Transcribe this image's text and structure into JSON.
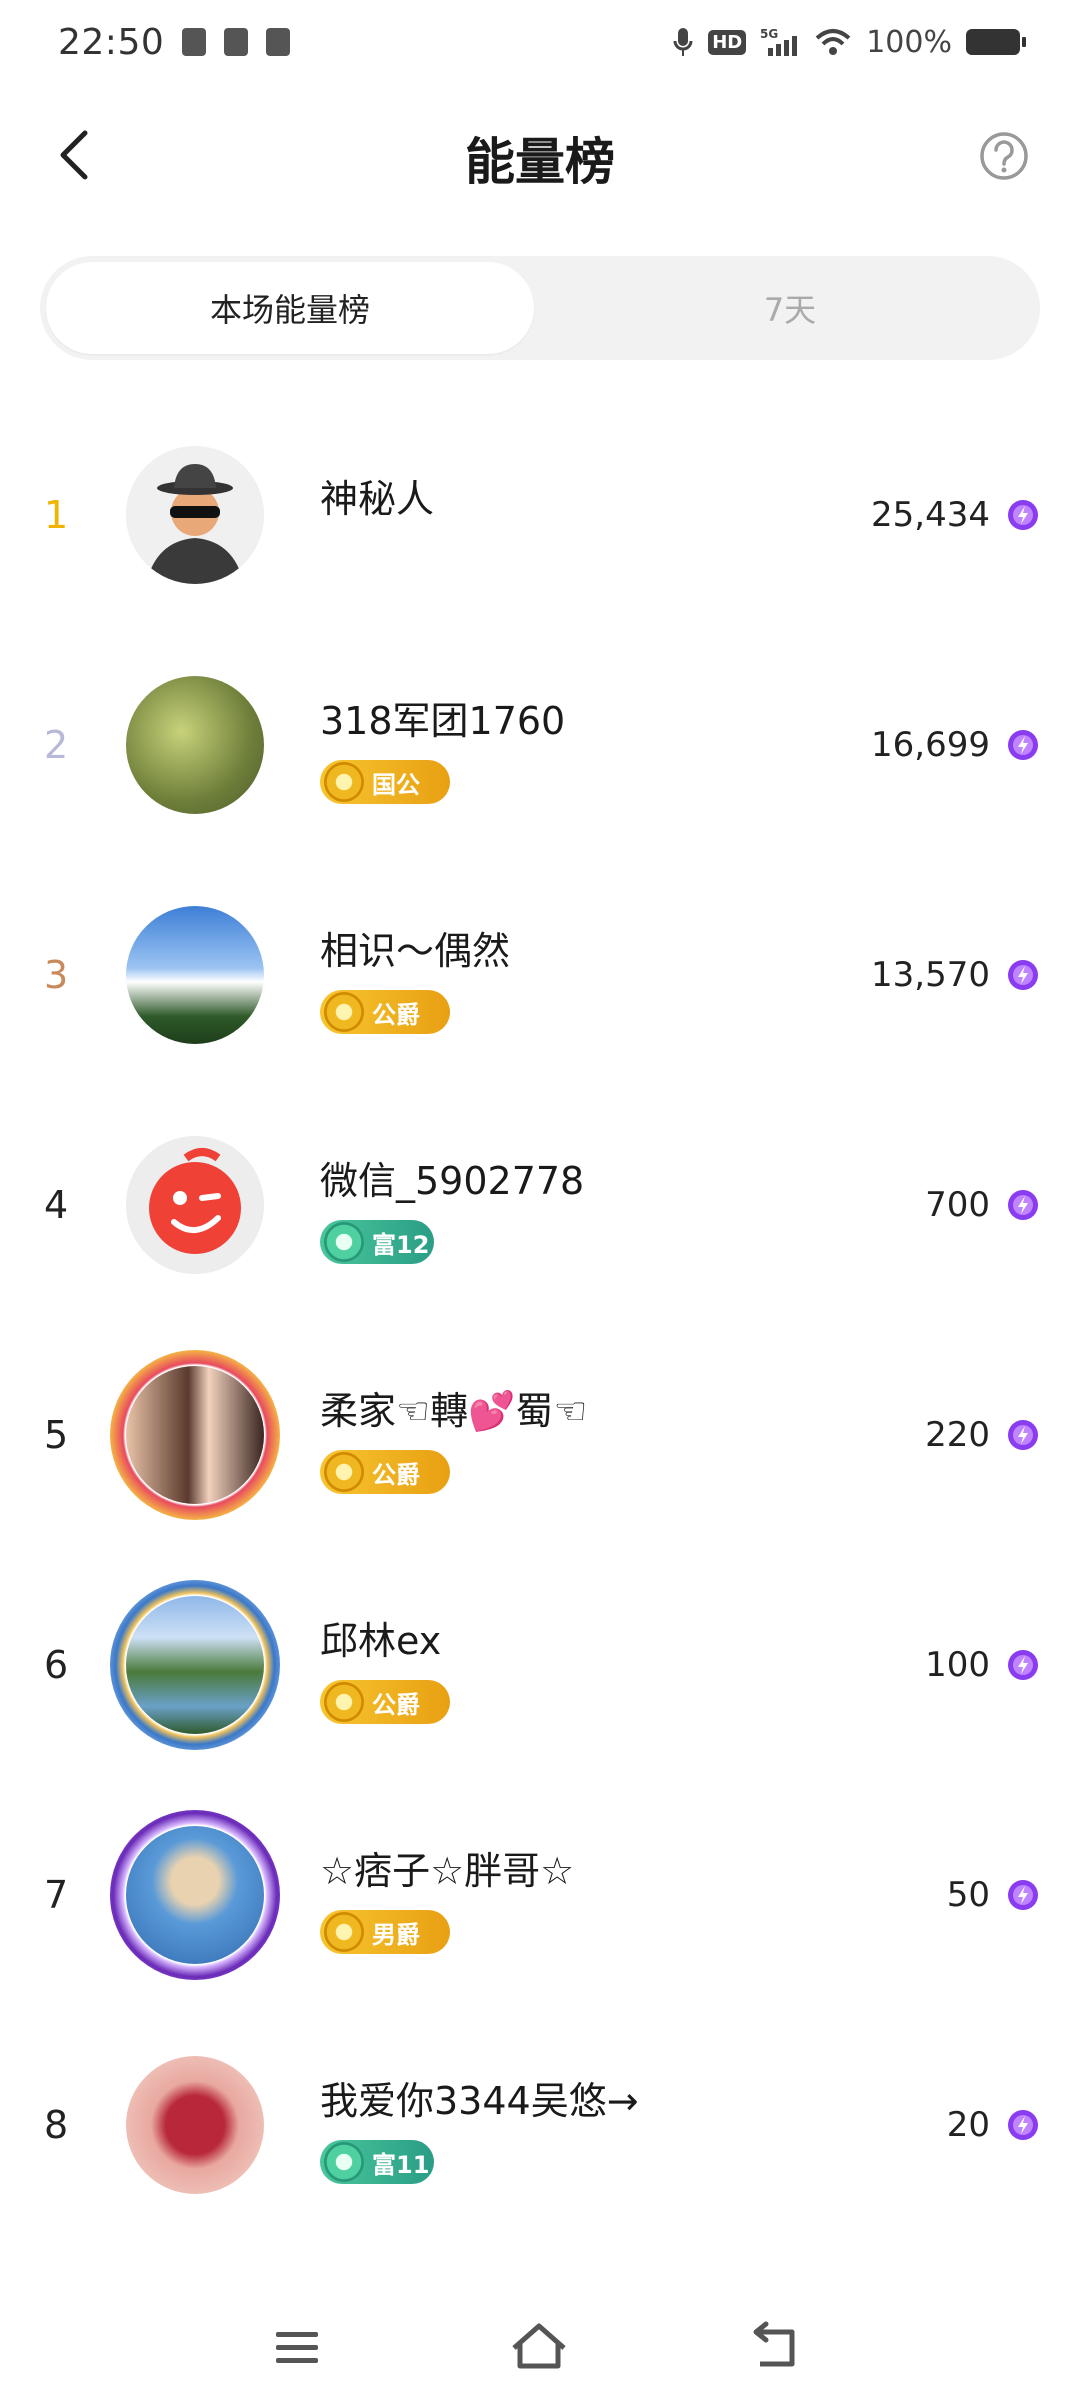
{
  "status_bar": {
    "time": "22:50",
    "network": "5G",
    "battery": "100%"
  },
  "header": {
    "title": "能量榜"
  },
  "tabs": [
    {
      "label": "本场能量榜",
      "active": true
    },
    {
      "label": "7天",
      "active": false
    }
  ],
  "rankings": [
    {
      "rank": "1",
      "name": "神秘人",
      "badge": "",
      "badge_style": "",
      "score": "25,434",
      "rank_color": "#f0b400"
    },
    {
      "rank": "2",
      "name": "318军团1760",
      "badge": "国公",
      "badge_style": "gold",
      "score": "16,699",
      "rank_color": "#b8b8d8"
    },
    {
      "rank": "3",
      "name": "相识～偶然",
      "badge": "公爵",
      "badge_style": "gold",
      "score": "13,570",
      "rank_color": "#c88a5c"
    },
    {
      "rank": "4",
      "name": "微信_5902778",
      "badge": "富12",
      "badge_style": "teal",
      "score": "700",
      "rank_color": "#222222"
    },
    {
      "rank": "5",
      "name": "柔家☜轉💕蜀☜",
      "badge": "公爵",
      "badge_style": "gold",
      "score": "220",
      "rank_color": "#222222"
    },
    {
      "rank": "6",
      "name": "邱林ex",
      "badge": "公爵",
      "badge_style": "gold",
      "score": "100",
      "rank_color": "#222222"
    },
    {
      "rank": "7",
      "name": "☆痞子☆胖哥☆",
      "badge": "男爵",
      "badge_style": "gold",
      "score": "50",
      "rank_color": "#222222"
    },
    {
      "rank": "8",
      "name": "我爱你3344吴悠→",
      "badge": "富11",
      "badge_style": "teal",
      "score": "20",
      "rank_color": "#222222"
    }
  ],
  "colors": {
    "energy": "#8a3cf0",
    "gold_badge": "#f0b020",
    "teal_badge": "#35b08e"
  }
}
